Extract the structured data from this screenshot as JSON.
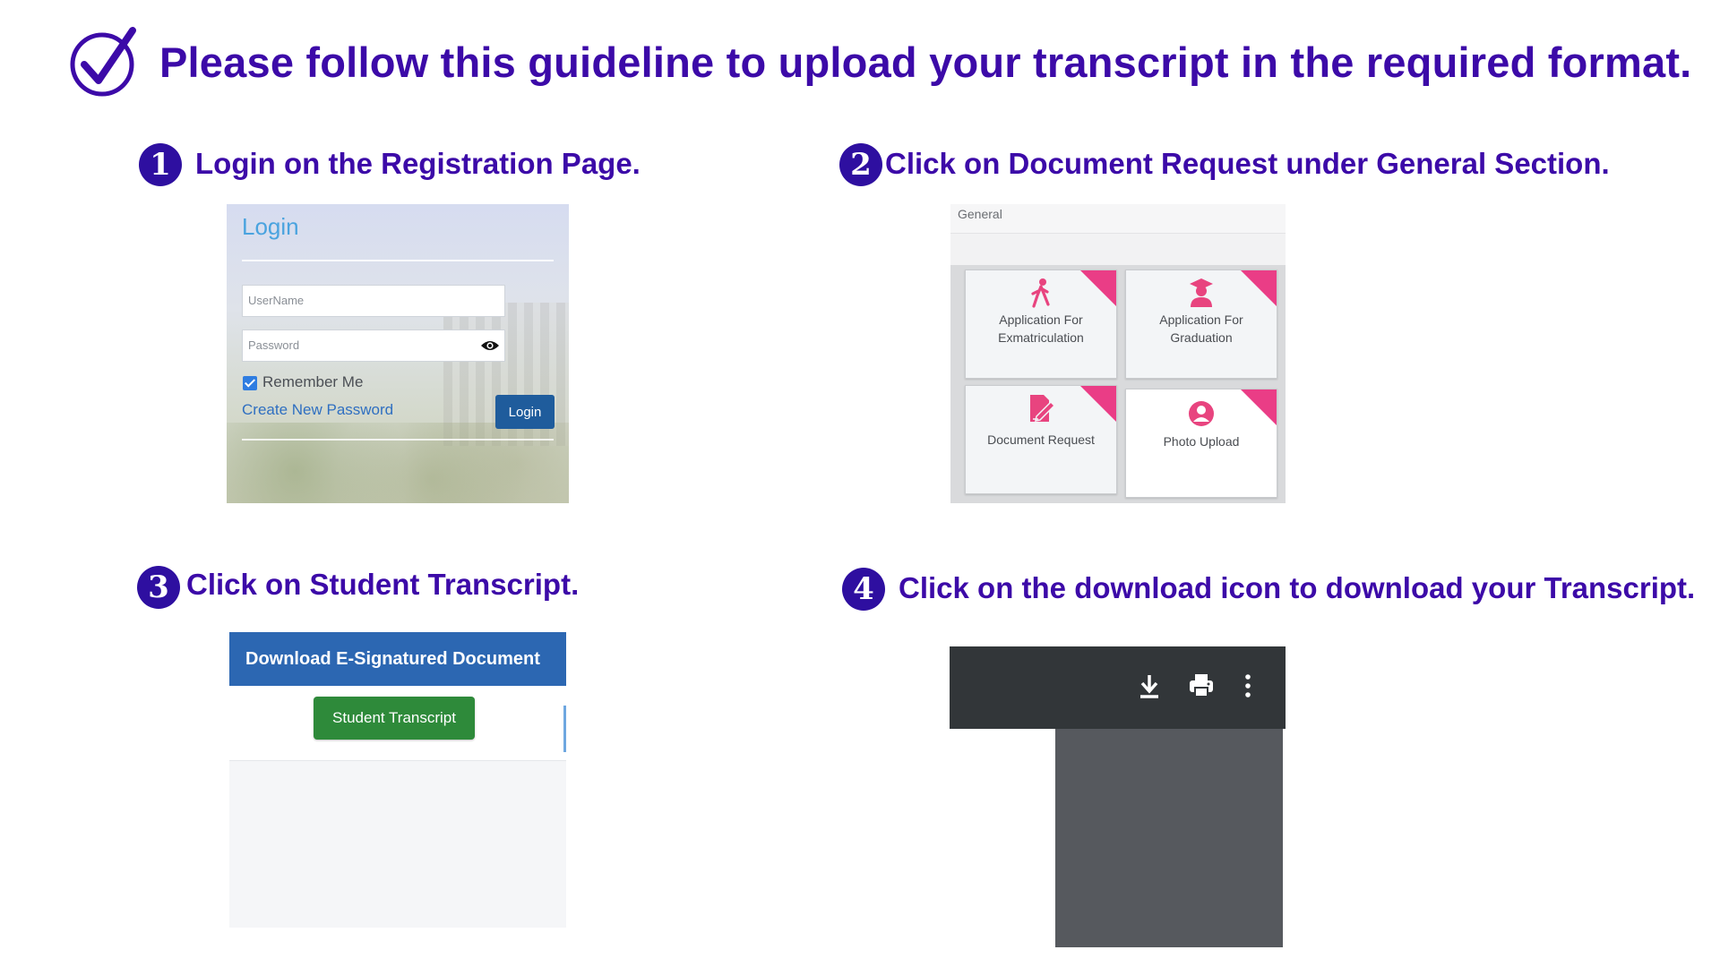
{
  "header": {
    "title": "Please follow this guideline to upload your transcript in the required format.",
    "icon": "check-circle-icon"
  },
  "colors": {
    "heading": "#3c0aa8",
    "badge": "#2e0fa0",
    "tile_accent": "#ea3d86",
    "panel_blue": "#2c67b2",
    "button_green": "#2e8a3a"
  },
  "steps": [
    {
      "number": "1",
      "text": "Login on the Registration Page."
    },
    {
      "number": "2",
      "text": "Click on Document Request under General Section."
    },
    {
      "number": "3",
      "text": "Click on Student Transcript."
    },
    {
      "number": "4",
      "text": "Click on the download icon to download your Transcript."
    }
  ],
  "login": {
    "title": "Login",
    "username_placeholder": "UserName",
    "password_placeholder": "Password",
    "remember_label": "Remember Me",
    "create_password_link": "Create New Password",
    "login_button": "Login"
  },
  "general": {
    "section_label": "General",
    "tiles": [
      {
        "line1": "Application For",
        "line2": "Exmatriculation",
        "icon": "walking-person-icon"
      },
      {
        "line1": "Application For",
        "line2": "Graduation",
        "icon": "graduate-icon"
      },
      {
        "line1": "Document Request",
        "line2": "",
        "icon": "document-edit-icon"
      },
      {
        "line1": "Photo Upload",
        "line2": "",
        "icon": "user-circle-icon"
      }
    ]
  },
  "esign": {
    "header": "Download E-Signatured Document",
    "transcript_button": "Student Transcript"
  },
  "viewer": {
    "icons": [
      "download-icon",
      "print-icon",
      "more-vert-icon"
    ]
  }
}
